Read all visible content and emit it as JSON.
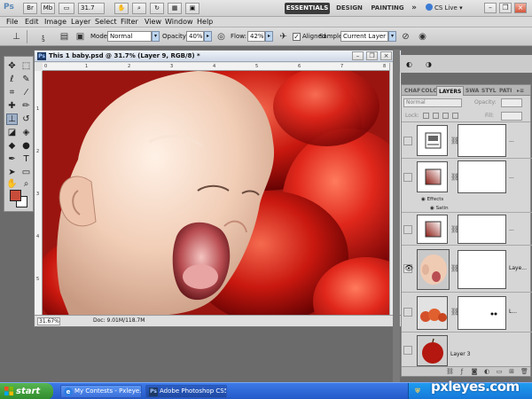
{
  "appbar": {
    "logo": "Ps",
    "zoom": "31.7",
    "workspaces": [
      "ESSENTIALS",
      "DESIGN",
      "PAINTING",
      "»"
    ],
    "cs_live": "CS Live"
  },
  "menu": [
    "File",
    "Edit",
    "Image",
    "Layer",
    "Select",
    "Filter",
    "View",
    "Window",
    "Help"
  ],
  "options": {
    "brush_size": "5",
    "mode_label": "Mode:",
    "mode_value": "Normal",
    "opacity_label": "Opacity:",
    "opacity_value": "40%",
    "flow_label": "Flow:",
    "flow_value": "42%",
    "aligned_label": "Aligned",
    "sample_label": "Sample:",
    "sample_value": "Current Layer"
  },
  "colors": {
    "foreground": "#c84c3a",
    "background": "#ffffff",
    "accent": "#3b3b3b"
  },
  "document": {
    "title": "This 1 baby.psd @ 31.7% (Layer 9, RGB/8) *",
    "ruler_ticks_top": [
      "0",
      "1",
      "2",
      "3",
      "4",
      "5",
      "6",
      "7",
      "8"
    ],
    "ruler_ticks_left": [
      "1",
      "2",
      "3",
      "4",
      "5"
    ],
    "zoom": "31.67%",
    "doc_info": "Doc: 9.01M/118.7M"
  },
  "layers_panel": {
    "tabs": [
      "CHAF",
      "COLC",
      "LAYERS",
      "SWA",
      "STYL",
      "PATI"
    ],
    "blend_mode": "Normal",
    "opacity_label": "Opacity:",
    "lock_label": "Lock:",
    "fill_label": "Fill:",
    "layers": [
      {
        "name": "...",
        "visible": false
      },
      {
        "name": "...",
        "visible": false,
        "effects": [
          "Effects",
          "Satin"
        ]
      },
      {
        "name": "...",
        "visible": false
      },
      {
        "name": "Laye...",
        "visible": true
      },
      {
        "name": "L...",
        "visible": false
      },
      {
        "name": "Layer 3",
        "visible": false
      }
    ]
  },
  "taskbar": {
    "start": "start",
    "items": [
      "My Contests - Pxleye...",
      "Adobe Photoshop CS5"
    ]
  },
  "watermark": "pxleyes.com"
}
